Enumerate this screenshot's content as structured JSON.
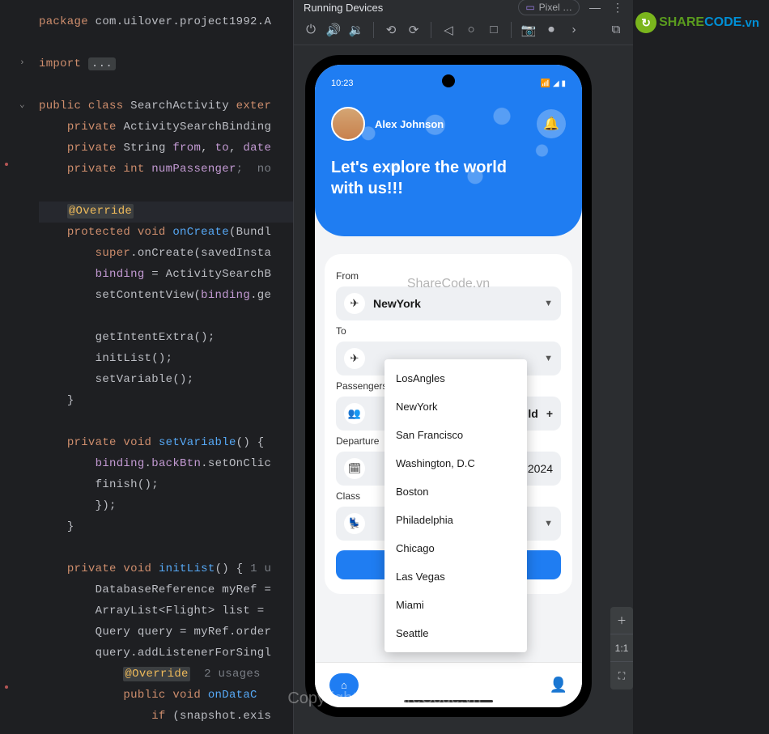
{
  "code": {
    "package_kw": "package",
    "package_name": " com.uilover.project1992.A",
    "import_kw": "import ",
    "import_ellipsis": "...",
    "class_decl_kw1": "public class ",
    "class_name": "SearchActivity ",
    "class_decl_kw2": "exter",
    "priv1_kw": "private ",
    "priv1_type": "ActivitySearchBinding",
    "priv2_kw": "private ",
    "priv2_type": "String ",
    "priv2_f1": "from",
    "priv2_comma": ", ",
    "priv2_f2": "to",
    "priv2_f3": "date",
    "priv3_kw": "private int ",
    "priv3_f": "numPassenger",
    "priv3_tail": ";  no",
    "override": "@Override",
    "oncreate_kw": "protected void ",
    "oncreate_name": "onCreate",
    "oncreate_params": "(Bundl",
    "super_call": "super",
    "super_tail": ".onCreate(savedInsta",
    "binding_assign": "binding",
    "binding_eq": " = ActivitySearchB",
    "setcontent": "setContentView(",
    "setcontent_b": "binding",
    "setcontent_tail": ".ge",
    "call_getintent": "getIntentExtra();",
    "call_initlist": "initList();",
    "call_setvar": "setVariable();",
    "brace_close": "}",
    "setvar_kw": "private void ",
    "setvar_name": "setVariable",
    "setvar_tail": "() {",
    "setvar_l1a": "binding",
    "setvar_l1b": ".",
    "setvar_l1c": "backBtn",
    "setvar_l1d": ".setOnClic",
    "setvar_l2": "finish();",
    "setvar_l3": "});",
    "initlist_kw": "private void ",
    "initlist_name": "initList",
    "initlist_tail": "() { ",
    "initlist_usage": "1 u",
    "initlist_l1": "DatabaseReference myRef =",
    "initlist_l2": "ArrayList<Flight> list =",
    "initlist_l3": "Query query = myRef.order",
    "initlist_l4": "query.addListenerForSingl",
    "initlist_override": "@Override",
    "initlist_usages": "  2 usages",
    "initlist_l5_kw": "public void ",
    "initlist_l5_name": "onDataC",
    "initlist_l6_kw": "if ",
    "initlist_l6": "(snapshot.exis"
  },
  "devices": {
    "title": "Running Devices",
    "tab": "Pixel …"
  },
  "sharecode": {
    "text1": "SHARE",
    "text2": "CODE",
    "vn": ".vn"
  },
  "phone": {
    "time": "10:23",
    "username": "Alex Johnson",
    "headline_l1": "Let's explore the world",
    "headline_l2": " with us!!!"
  },
  "form": {
    "from_label": "From",
    "from_value": "NewYork",
    "to_label": "To",
    "passengers_label": "Passengers",
    "passengers_partial": "ld",
    "departure_label": "Departure",
    "departure_partial": "2024",
    "class_label": "Class",
    "watermark": "ShareCode.vn"
  },
  "dropdown": {
    "items": [
      "LosAngles",
      "NewYork",
      "San Francisco",
      "Washington, D.C",
      "Boston",
      "Philadelphia",
      "Chicago",
      "Las Vegas",
      "Miami",
      "Seattle"
    ]
  },
  "zoom": {
    "ratio": "1:1"
  },
  "copyright": "Copyright © ShareCode.vn"
}
